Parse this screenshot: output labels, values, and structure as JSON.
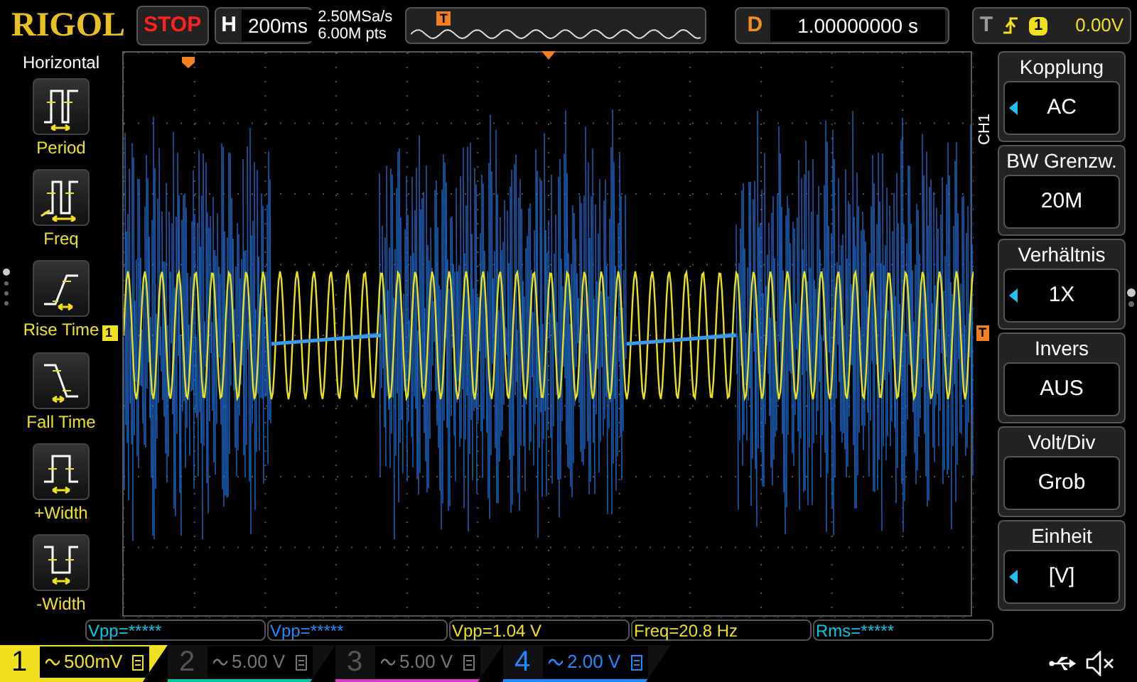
{
  "top_bar": {
    "logo": "RIGOL",
    "run_state": "STOP",
    "horizontal": {
      "label": "H",
      "value": "200ms"
    },
    "sample_rate": "2.50MSa/s",
    "memory_depth": "6.00M pts",
    "delay": {
      "label": "D",
      "value": "1.00000000 s"
    },
    "trigger": {
      "label": "T",
      "source": "1",
      "level": "0.00V"
    }
  },
  "left_menu": {
    "title": "Horizontal",
    "items": [
      {
        "label": "Period",
        "kind": "period"
      },
      {
        "label": "Freq",
        "kind": "freq"
      },
      {
        "label": "Rise Time",
        "kind": "rise"
      },
      {
        "label": "Fall Time",
        "kind": "fall"
      },
      {
        "label": "+Width",
        "kind": "pwidth"
      },
      {
        "label": "-Width",
        "kind": "nwidth"
      }
    ],
    "page_dots": [
      {
        "selected": true
      },
      {
        "selected": false
      },
      {
        "selected": false
      },
      {
        "selected": false
      }
    ]
  },
  "screen": {
    "ch1_marker": "1",
    "trigger_marker": "T",
    "trigger_position_marker": "T"
  },
  "right_menu": {
    "channel": "CH1",
    "items": [
      {
        "title": "Kopplung",
        "value": "AC",
        "arrow": true
      },
      {
        "title": "BW Grenzw.",
        "value": "20M",
        "arrow": false
      },
      {
        "title": "Verhältnis",
        "value": "1X",
        "arrow": true
      },
      {
        "title": "Invers",
        "value": "AUS",
        "arrow": false
      },
      {
        "title": "Volt/Div",
        "value": "Grob",
        "arrow": false
      },
      {
        "title": "Einheit",
        "value": "[V]",
        "arrow": true
      }
    ],
    "page_dots": [
      {
        "selected": true
      },
      {
        "selected": false
      }
    ]
  },
  "measurements": [
    {
      "text": "Vpp=*****",
      "color": "#00c8e6"
    },
    {
      "text": "Vpp=*****",
      "color": "#1e8cff"
    },
    {
      "text": "Vpp=1.04 V",
      "color": "#f0e020"
    },
    {
      "text": "Freq=20.8 Hz",
      "color": "#f0e020"
    },
    {
      "text": "Rms=*****",
      "color": "#00c8e6"
    }
  ],
  "channels": [
    {
      "number": "1",
      "scale": "500mV",
      "color": "#f0e020",
      "enabled": true,
      "selected": true
    },
    {
      "number": "2",
      "scale": "5.00 V",
      "color": "#00c8a0",
      "enabled": false,
      "selected": false
    },
    {
      "number": "3",
      "scale": "5.00 V",
      "color": "#d040c0",
      "enabled": false,
      "selected": false
    },
    {
      "number": "4",
      "scale": "2.00 V",
      "color": "#1e8cff",
      "enabled": true,
      "selected": false
    }
  ]
}
